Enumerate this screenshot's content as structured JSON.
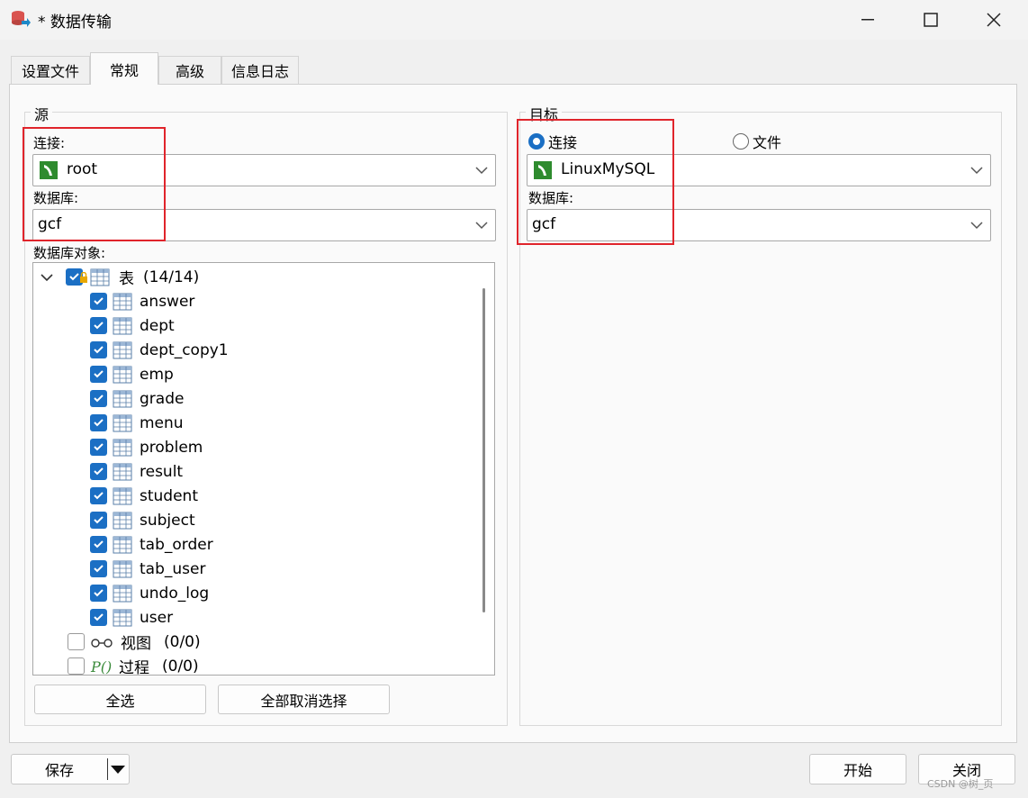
{
  "window": {
    "title": "* 数据传输"
  },
  "tabs": [
    {
      "label": "设置文件"
    },
    {
      "label": "常规"
    },
    {
      "label": "高级"
    },
    {
      "label": "信息日志"
    }
  ],
  "source": {
    "group_label": "源",
    "connection_label": "连接:",
    "connection_value": "root",
    "database_label": "数据库:",
    "database_value": "gcf",
    "objects_label": "数据库对象:",
    "tables_node": {
      "label": "表",
      "count": "(14/14)"
    },
    "tables": [
      "answer",
      "dept",
      "dept_copy1",
      "emp",
      "grade",
      "menu",
      "problem",
      "result",
      "student",
      "subject",
      "tab_order",
      "tab_user",
      "undo_log",
      "user"
    ],
    "views_node": {
      "label": "视图",
      "count": "(0/0)"
    },
    "procs_node": {
      "label": "过程",
      "count": "(0/0)"
    },
    "select_all": "全选",
    "deselect_all": "全部取消选择"
  },
  "target": {
    "group_label": "目标",
    "radio_connection": "连接",
    "radio_file": "文件",
    "connection_value": "LinuxMySQL",
    "database_label": "数据库:",
    "database_value": "gcf"
  },
  "footer": {
    "save": "保存",
    "start": "开始",
    "close": "关闭",
    "watermark": "CSDN @树_页"
  },
  "colors": {
    "accent": "#1b6fc4",
    "highlight_box": "#e0242b",
    "mysql_icon": "#2e8b2e"
  }
}
